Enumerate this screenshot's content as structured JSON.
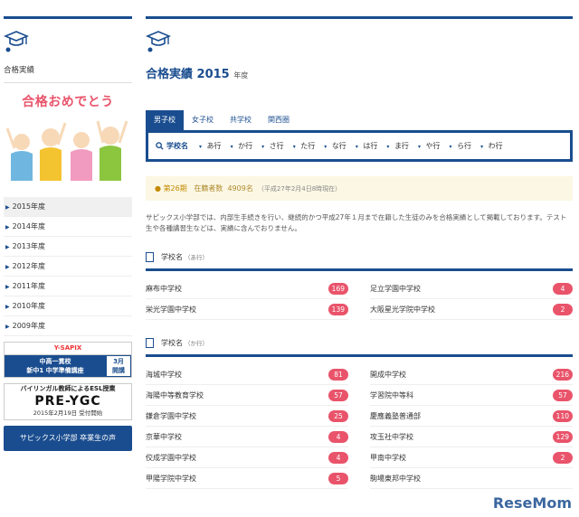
{
  "sidebar": {
    "title": "合格実績",
    "banner_text": "合格おめでとう",
    "years": [
      "2015年度",
      "2014年度",
      "2013年度",
      "2012年度",
      "2011年度",
      "2010年度",
      "2009年度"
    ],
    "ad1": {
      "brand": "Y-SAPIX",
      "line1": "中高一貫校",
      "line2": "新中1 中学準備講座",
      "badge1": "3月",
      "badge2": "開講"
    },
    "ad2": {
      "line1": "バイリンガル教師によるESL授業",
      "logo": "PRE-YGC",
      "date": "2015年2月19日 受付開始"
    },
    "button": "サピックス小学部 卒業生の声"
  },
  "main": {
    "title": "合格実績",
    "year": "2015",
    "suffix": "年度",
    "tabs": [
      "男子校",
      "女子校",
      "共学校",
      "関西圏"
    ],
    "search_label": "学校名",
    "kana": [
      "あ行",
      "か行",
      "さ行",
      "た行",
      "な行",
      "は行",
      "ま行",
      "や行",
      "ら行",
      "わ行"
    ],
    "notice": {
      "period": "第26期",
      "label": "在籍者数",
      "count": "4909名",
      "date": "（平成27年2月4日8時現在）"
    },
    "description": "サピックス小学部では、内部生手続きを行い、継続的かつ平成27年１月まで在籍した生徒のみを合格実績として掲載しております。テスト生や各種講習生などは、実績に含んでおりません。",
    "sections": [
      {
        "title": "学校名",
        "sub": "（あ行）",
        "left": [
          {
            "name": "麻布中学校",
            "count": "169"
          },
          {
            "name": "栄光学園中学校",
            "count": "139"
          }
        ],
        "right": [
          {
            "name": "足立学園中学校",
            "count": "4"
          },
          {
            "name": "大阪星光学院中学校",
            "count": "2"
          }
        ]
      },
      {
        "title": "学校名",
        "sub": "（か行）",
        "left": [
          {
            "name": "海城中学校",
            "count": "81"
          },
          {
            "name": "海陽中等教育学校",
            "count": "57"
          },
          {
            "name": "鎌倉学園中学校",
            "count": "25"
          },
          {
            "name": "京華中学校",
            "count": "4"
          },
          {
            "name": "佼成学園中学校",
            "count": "4"
          },
          {
            "name": "甲陽学院中学校",
            "count": "5"
          }
        ],
        "right": [
          {
            "name": "開成中学校",
            "count": "216"
          },
          {
            "name": "学習院中等科",
            "count": "57"
          },
          {
            "name": "慶應義塾普通部",
            "count": "110"
          },
          {
            "name": "攻玉社中学校",
            "count": "129"
          },
          {
            "name": "甲南中学校",
            "count": "2"
          },
          {
            "name": "駒場東邦中学校",
            "count": ""
          }
        ]
      }
    ]
  },
  "watermark": "ReseMom",
  "colors": {
    "primary": "#1a4d8f",
    "badge": "#e9546b",
    "notice_bg": "#fbf7e4"
  }
}
